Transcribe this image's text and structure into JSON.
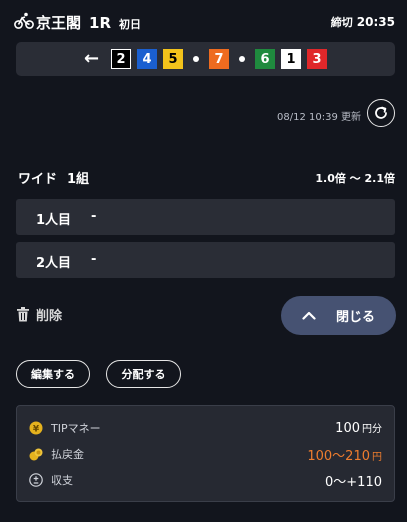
{
  "header": {
    "venue": "京王閣",
    "race": "1R",
    "day": "初日",
    "deadline_label": "締切",
    "deadline_time": "20:35"
  },
  "lineup": {
    "arrow": "←",
    "groups": [
      [
        {
          "n": "2",
          "bg": "#000000",
          "fg": "#ffffff",
          "border": "#ffffff"
        },
        {
          "n": "4",
          "bg": "#1a5fd0",
          "fg": "#ffffff",
          "border": "#1a5fd0"
        },
        {
          "n": "5",
          "bg": "#f3c31b",
          "fg": "#000000",
          "border": "#f3c31b"
        }
      ],
      [
        {
          "n": "7",
          "bg": "#ee6b1f",
          "fg": "#ffffff",
          "border": "#ee6b1f"
        }
      ],
      [
        {
          "n": "6",
          "bg": "#1f8a3e",
          "fg": "#ffffff",
          "border": "#1f8a3e"
        },
        {
          "n": "1",
          "bg": "#ffffff",
          "fg": "#000000",
          "border": "#ffffff"
        },
        {
          "n": "3",
          "bg": "#e0272a",
          "fg": "#ffffff",
          "border": "#e0272a"
        }
      ]
    ]
  },
  "update": {
    "text": "08/12 10:39 更新",
    "icon": "refresh-icon"
  },
  "bet": {
    "type": "ワイド",
    "count": "1組",
    "odds": "1.0倍 ～ 2.1倍",
    "rows": [
      {
        "label": "1人目",
        "value": "-"
      },
      {
        "label": "2人目",
        "value": "-"
      }
    ]
  },
  "actions": {
    "delete_label": "削除",
    "close_label": "閉じる",
    "edit_label": "編集する",
    "distribute_label": "分配する"
  },
  "summary": {
    "tip_label": "TIPマネー",
    "tip_value": "100",
    "tip_unit": "円分",
    "payout_label": "払戻金",
    "payout_value": "100～210",
    "payout_unit": "円",
    "balance_label": "収支",
    "balance_value": "0～+110"
  },
  "colors": {
    "accent": "#465272",
    "orange": "#ee7d2e",
    "bg": "#12151d",
    "panel": "#2a2d36"
  }
}
